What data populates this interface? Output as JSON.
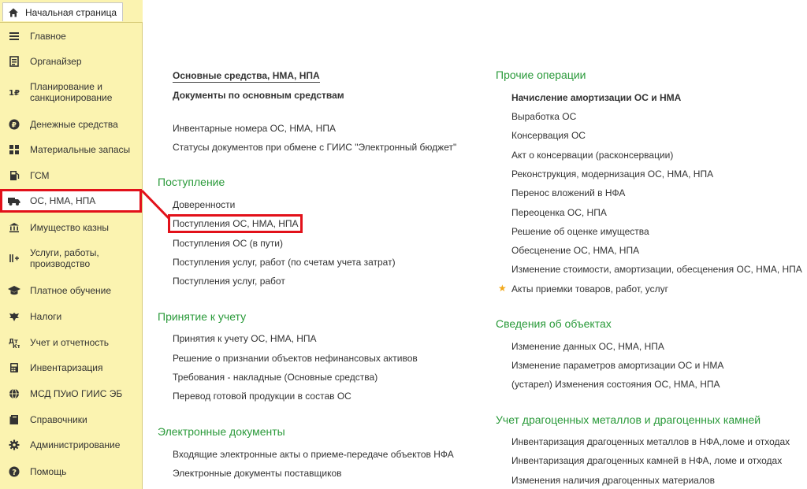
{
  "tab": {
    "home_label": "Начальная страница",
    "icon": "home-icon"
  },
  "sidebar": {
    "items": [
      {
        "label": "Главное",
        "icon": "menu-lines-icon"
      },
      {
        "label": "Органайзер",
        "icon": "organizer-icon"
      },
      {
        "label": "Планирование и санкционирование",
        "icon": "planning-icon"
      },
      {
        "label": "Денежные средства",
        "icon": "money-icon"
      },
      {
        "label": "Материальные запасы",
        "icon": "grid-icon"
      },
      {
        "label": "ГСМ",
        "icon": "fuel-icon"
      },
      {
        "label": "ОС, НМА, НПА",
        "icon": "truck-icon",
        "active": true
      },
      {
        "label": "Имущество казны",
        "icon": "bank-icon"
      },
      {
        "label": "Услуги, работы, производство",
        "icon": "services-icon"
      },
      {
        "label": "Платное обучение",
        "icon": "graduation-cap-icon"
      },
      {
        "label": "Налоги",
        "icon": "eagle-icon"
      },
      {
        "label": "Учет и отчетность",
        "icon": "accounting-icon"
      },
      {
        "label": "Инвентаризация",
        "icon": "calculator-icon"
      },
      {
        "label": "МСД ПУиО ГИИС ЭБ",
        "icon": "globe-icon"
      },
      {
        "label": "Справочники",
        "icon": "book-icon"
      },
      {
        "label": "Администрирование",
        "icon": "gear-icon"
      },
      {
        "label": "Помощь",
        "icon": "help-icon"
      }
    ]
  },
  "left_column": {
    "top_links": [
      "Основные средства, НМА, НПА",
      "Документы по основным средствам",
      "Инвентарные номера ОС, НМА, НПА",
      "Статусы документов при обмене с ГИИС \"Электронный бюджет\""
    ],
    "receipt": {
      "header": "Поступление",
      "items": [
        "Доверенности",
        "Поступления ОС, НМА, НПА",
        "Поступления ОС (в пути)",
        "Поступления услуг, работ (по счетам учета затрат)",
        "Поступления услуг, работ"
      ]
    },
    "acceptance": {
      "header": "Принятие к учету",
      "items": [
        "Принятия к учету ОС, НМА, НПА",
        "Решение о признании объектов нефинансовых активов",
        "Требования - накладные (Основные средства)",
        "Перевод готовой продукции в состав ОС"
      ]
    },
    "edocs": {
      "header": "Электронные документы",
      "items": [
        "Входящие электронные акты о приеме-передаче объектов НФА",
        "Электронные документы поставщиков"
      ]
    }
  },
  "right_column": {
    "other_ops": {
      "header": "Прочие операции",
      "items": [
        "Начисление амортизации ОС и НМА",
        "Выработка ОС",
        "Консервация ОС",
        "Акт о консервации (расконсервации)",
        "Реконструкция, модернизация ОС, НМА, НПА",
        "Перенос вложений в НФА",
        "Переоценка ОС, НПА",
        "Решение об оценке имущества",
        "Обесценение ОС, НМА, НПА",
        "Изменение стоимости, амортизации, обесценения ОС, НМА, НПА",
        "Акты приемки товаров, работ, услуг"
      ]
    },
    "object_info": {
      "header": "Сведения об объектах",
      "items": [
        "Изменение данных ОС, НМА, НПА",
        "Изменение параметров амортизации ОС и НМА",
        "(устарел) Изменения состояния ОС, НМА, НПА"
      ]
    },
    "precious": {
      "header": "Учет драгоценных металлов и драгоценных камней",
      "items": [
        "Инвентаризация драгоценных металлов в НФА,ломе и отходах",
        "Инвентаризация драгоценных камней в НФА, ломе и отходах",
        "Изменения наличия драгоценных материалов"
      ]
    }
  },
  "colors": {
    "sidebar_bg": "#fbf3b0",
    "section_header": "#2a9a3a",
    "highlight": "#e2111a",
    "favorite_star": "#f2a81a"
  }
}
